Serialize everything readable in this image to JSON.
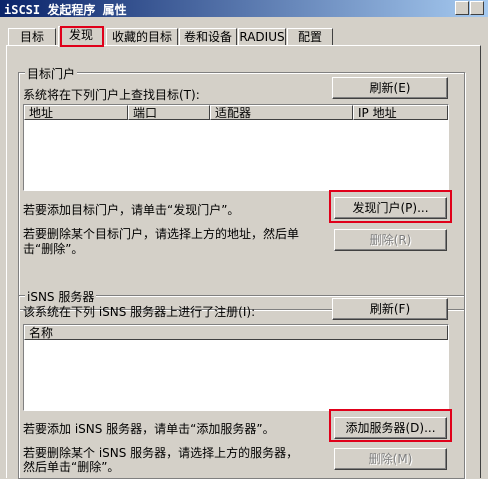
{
  "window": {
    "title": "iSCSI 发起程序 属性"
  },
  "tabs": [
    {
      "label": "目标"
    },
    {
      "label": "发现"
    },
    {
      "label": "收藏的目标"
    },
    {
      "label": "卷和设备"
    },
    {
      "label": "RADIUS"
    },
    {
      "label": "配置"
    }
  ],
  "active_tab": "发现",
  "portal_group": {
    "title": "目标门户",
    "refresh_label": "刷新(E)",
    "description": "系统将在下列门户上查找目标(T):",
    "columns": [
      "地址",
      "端口",
      "适配器",
      "IP 地址"
    ],
    "rows": [],
    "add_hint": "若要添加目标门户，请单击“发现门户”。",
    "discover_label": "发现门户(P)...",
    "remove_hint_line1": "若要删除某个目标门户，请选择上方的地址，然后单",
    "remove_hint_line2": "击“删除”。",
    "remove_label": "删除(R)"
  },
  "isns_group": {
    "title": "iSNS 服务器",
    "description": "该系统在下列 iSNS 服务器上进行了注册(I):",
    "refresh_label": "刷新(F)",
    "columns": [
      "名称"
    ],
    "rows": [],
    "add_hint": "若要添加 iSNS 服务器，请单击“添加服务器”。",
    "add_label": "添加服务器(D)...",
    "remove_hint_line1": "若要删除某个 iSNS 服务器，请选择上方的服务器，",
    "remove_hint_line2": "然后单击“删除”。",
    "remove_label": "删除(M)"
  },
  "colors": {
    "highlight": "#e0001a",
    "dialog_bg": "#d4d0c8",
    "titlebar": "#0a246a"
  }
}
